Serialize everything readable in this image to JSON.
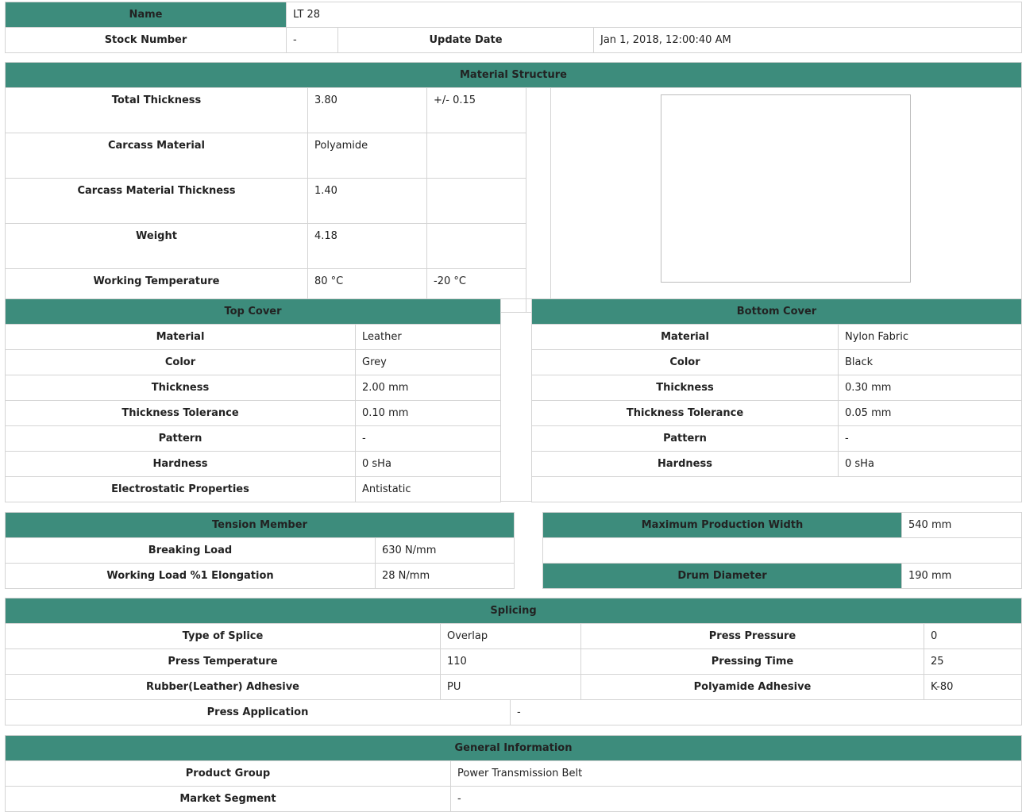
{
  "header": {
    "name_label": "Name",
    "name_value": "LT 28",
    "stock_label": "Stock Number",
    "stock_value": "-",
    "update_label": "Update Date",
    "update_value": "Jan 1, 2018, 12:00:40 AM"
  },
  "material_structure": {
    "title": "Material Structure",
    "rows": [
      {
        "label": "Total Thickness",
        "value": "3.80",
        "extra": "+/- 0.15"
      },
      {
        "label": "Carcass Material",
        "value": "Polyamide",
        "extra": ""
      },
      {
        "label": "Carcass Material Thickness",
        "value": "1.40",
        "extra": ""
      },
      {
        "label": "Weight",
        "value": "4.18",
        "extra": ""
      },
      {
        "label": "Working Temperature",
        "value": "80 °C",
        "extra": "-20 °C"
      }
    ]
  },
  "top_cover": {
    "title": "Top Cover",
    "rows": [
      {
        "label": "Material",
        "value": "Leather"
      },
      {
        "label": "Color",
        "value": "Grey"
      },
      {
        "label": "Thickness",
        "value": "2.00 mm"
      },
      {
        "label": "Thickness Tolerance",
        "value": "0.10 mm"
      },
      {
        "label": "Pattern",
        "value": "-"
      },
      {
        "label": "Hardness",
        "value": "0 sHa"
      },
      {
        "label": "Electrostatic Properties",
        "value": "Antistatic"
      }
    ]
  },
  "bottom_cover": {
    "title": "Bottom Cover",
    "rows": [
      {
        "label": "Material",
        "value": "Nylon Fabric"
      },
      {
        "label": "Color",
        "value": "Black"
      },
      {
        "label": "Thickness",
        "value": "0.30 mm"
      },
      {
        "label": "Thickness Tolerance",
        "value": "0.05 mm"
      },
      {
        "label": "Pattern",
        "value": "-"
      },
      {
        "label": "Hardness",
        "value": "0 sHa"
      }
    ]
  },
  "tension_member": {
    "title": "Tension Member",
    "rows": [
      {
        "label": "Breaking Load",
        "value": "630 N/mm"
      },
      {
        "label": "Working Load %1 Elongation",
        "value": "28 N/mm"
      }
    ]
  },
  "production": {
    "max_width_label": "Maximum Production Width",
    "max_width_value": "540 mm",
    "drum_label": "Drum Diameter",
    "drum_value": "190 mm"
  },
  "splicing": {
    "title": "Splicing",
    "type_label": "Type of Splice",
    "type_value": "Overlap",
    "press_pressure_label": "Press Pressure",
    "press_pressure_value": "0",
    "press_temp_label": "Press Temperature",
    "press_temp_value": "110",
    "pressing_time_label": "Pressing Time",
    "pressing_time_value": "25",
    "rubber_adhesive_label": "Rubber(Leather) Adhesive",
    "rubber_adhesive_value": "PU",
    "polyamide_adhesive_label": "Polyamide Adhesive",
    "polyamide_adhesive_value": "K-80",
    "press_app_label": "Press Application",
    "press_app_value": "-"
  },
  "general": {
    "title": "General Information",
    "product_group_label": "Product Group",
    "product_group_value": "Power Transmission Belt",
    "market_segment_label": "Market Segment",
    "market_segment_value": "-"
  },
  "colors": {
    "header_bg": "#3d8c7c",
    "border": "#d4d4d4"
  }
}
